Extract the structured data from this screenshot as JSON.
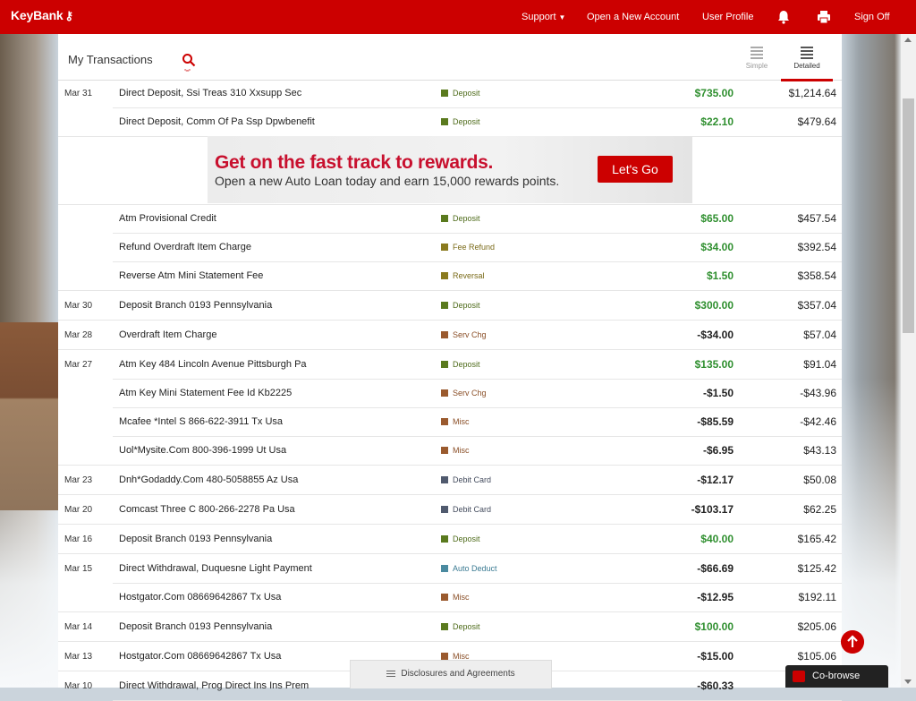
{
  "brand": {
    "name": "KeyBank",
    "accent": "#cc0000"
  },
  "nav": {
    "support": "Support",
    "open_account": "Open a New Account",
    "user_profile": "User Profile",
    "sign_off": "Sign Off"
  },
  "header": {
    "title": "My Transactions",
    "view_simple": "Simple",
    "view_detailed": "Detailed"
  },
  "ad": {
    "headline": "Get on the fast track to rewards.",
    "subline": "Open a new Auto Loan today and earn 15,000 rewards points.",
    "button": "Let's Go"
  },
  "transactions": [
    {
      "date": "Mar 31",
      "desc": "Direct Deposit, Ssi Treas 310 Xxsupp Sec",
      "cat": "Deposit",
      "amount": "$735.00",
      "balance": "$1,214.64"
    },
    {
      "date": "",
      "desc": "Direct Deposit, Comm Of Pa Ssp Dpwbenefit",
      "cat": "Deposit",
      "amount": "$22.10",
      "balance": "$479.64"
    },
    {
      "date": "",
      "desc": "Atm Provisional Credit",
      "cat": "Deposit",
      "amount": "$65.00",
      "balance": "$457.54"
    },
    {
      "date": "",
      "desc": "Refund Overdraft Item Charge",
      "cat": "Fee Refund",
      "amount": "$34.00",
      "balance": "$392.54"
    },
    {
      "date": "",
      "desc": "Reverse Atm Mini Statement Fee",
      "cat": "Reversal",
      "amount": "$1.50",
      "balance": "$358.54"
    },
    {
      "date": "Mar 30",
      "desc": "Deposit Branch 0193 Pennsylvania",
      "cat": "Deposit",
      "amount": "$300.00",
      "balance": "$357.04"
    },
    {
      "date": "Mar 28",
      "desc": "Overdraft Item Charge",
      "cat": "Serv Chg",
      "amount": "-$34.00",
      "balance": "$57.04"
    },
    {
      "date": "Mar 27",
      "desc": "Atm Key 484 Lincoln Avenue Pittsburgh Pa",
      "cat": "Deposit",
      "amount": "$135.00",
      "balance": "$91.04"
    },
    {
      "date": "",
      "desc": "Atm Key Mini Statement Fee Id Kb2225",
      "cat": "Serv Chg",
      "amount": "-$1.50",
      "balance": "-$43.96"
    },
    {
      "date": "",
      "desc": "Mcafee *Intel S 866-622-3911 Tx Usa",
      "cat": "Misc",
      "amount": "-$85.59",
      "balance": "-$42.46"
    },
    {
      "date": "",
      "desc": "Uol*Mysite.Com 800-396-1999 Ut Usa",
      "cat": "Misc",
      "amount": "-$6.95",
      "balance": "$43.13"
    },
    {
      "date": "Mar 23",
      "desc": "Dnh*Godaddy.Com 480-5058855 Az Usa",
      "cat": "Debit Card",
      "amount": "-$12.17",
      "balance": "$50.08"
    },
    {
      "date": "Mar 20",
      "desc": "Comcast Three C 800-266-2278 Pa Usa",
      "cat": "Debit Card",
      "amount": "-$103.17",
      "balance": "$62.25"
    },
    {
      "date": "Mar 16",
      "desc": "Deposit Branch 0193 Pennsylvania",
      "cat": "Deposit",
      "amount": "$40.00",
      "balance": "$165.42"
    },
    {
      "date": "Mar 15",
      "desc": "Direct Withdrawal, Duquesne Light Payment",
      "cat": "Auto Deduct",
      "amount": "-$66.69",
      "balance": "$125.42"
    },
    {
      "date": "",
      "desc": "Hostgator.Com 08669642867 Tx Usa",
      "cat": "Misc",
      "amount": "-$12.95",
      "balance": "$192.11"
    },
    {
      "date": "Mar 14",
      "desc": "Deposit Branch 0193 Pennsylvania",
      "cat": "Deposit",
      "amount": "$100.00",
      "balance": "$205.06"
    },
    {
      "date": "Mar 13",
      "desc": "Hostgator.Com 08669642867 Tx Usa",
      "cat": "Misc",
      "amount": "-$15.00",
      "balance": "$105.06"
    },
    {
      "date": "Mar 10",
      "desc": "Direct Withdrawal, Prog Direct Ins Ins Prem",
      "cat": "",
      "amount": "-$60.33",
      "balance": ""
    }
  ],
  "category_colors": {
    "Deposit": "#5a7a1e",
    "Fee Refund": "#8a7a1e",
    "Reversal": "#8a7a1e",
    "Serv Chg": "#9a5a2e",
    "Misc": "#9a5a2e",
    "Debit Card": "#505a6e",
    "Auto Deduct": "#4a8aa0"
  },
  "category_text_colors": {
    "Deposit": "#4e6b1a",
    "Fee Refund": "#7a6a18",
    "Reversal": "#7a6a18",
    "Serv Chg": "#8a4e26",
    "Misc": "#8a4e26",
    "Debit Card": "#444c5e",
    "Auto Deduct": "#3a7a92"
  },
  "footer": {
    "disclosures": "Disclosures and Agreements",
    "cobrowse": "Co-browse"
  }
}
